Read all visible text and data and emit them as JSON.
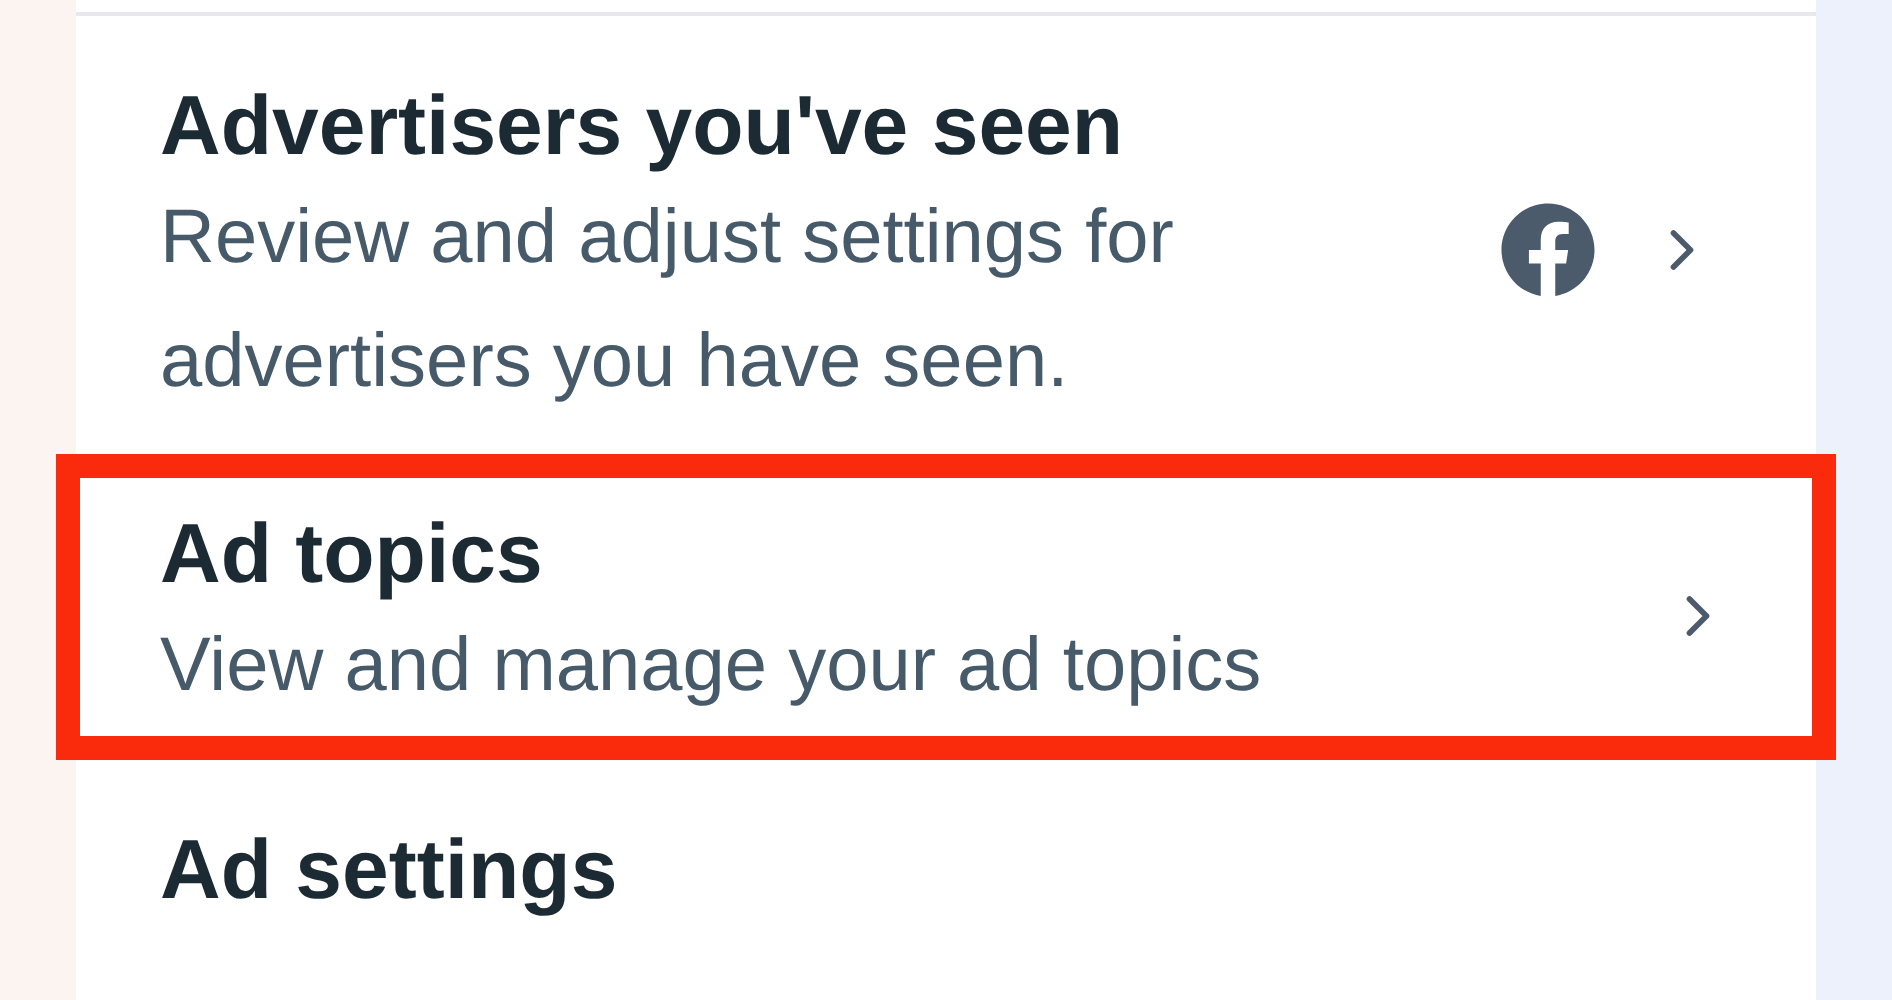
{
  "settings_list": [
    {
      "title": "Advertisers you've seen",
      "description": "Review and adjust settings for advertisers you have seen.",
      "app_icon": true,
      "highlighted": false
    },
    {
      "title": "Ad topics",
      "description": "View and manage your ad topics",
      "app_icon": false,
      "highlighted": true
    },
    {
      "title": "Ad settings",
      "app_icon": false,
      "highlighted": false
    }
  ]
}
